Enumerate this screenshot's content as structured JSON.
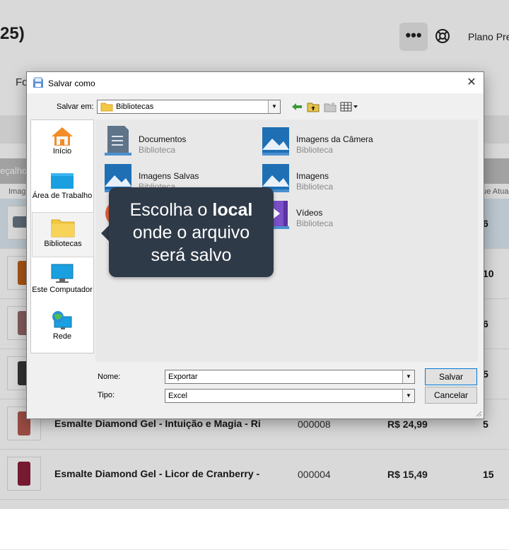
{
  "background": {
    "title": "25)",
    "more_label": "•••",
    "plan_label": "Plano Pre",
    "toolbar_label": "Fo",
    "header_left": "eçalho",
    "subheader_left": "Imag",
    "subheader_right": "que Atua",
    "rows": [
      {
        "name": "",
        "code": "",
        "price": "",
        "stock": "6",
        "bottle": "#6b7b88"
      },
      {
        "name": "",
        "code": "",
        "price": "",
        "stock": "10",
        "bottle": "#c5621a"
      },
      {
        "name": "",
        "code": "",
        "price": "",
        "stock": "6",
        "bottle": "#9a6b6b"
      },
      {
        "name": "",
        "code": "",
        "price": "",
        "stock": "5",
        "bottle": "#3a3a3a"
      },
      {
        "name": "Esmalte Diamond Gel - Intuição e Magia - Ri",
        "code": "000008",
        "price": "R$ 24,99",
        "stock": "5",
        "bottle": "#b55a4f"
      },
      {
        "name": "Esmalte Diamond Gel - Licor de Cranberry -",
        "code": "000004",
        "price": "R$ 15,49",
        "stock": "15",
        "bottle": "#8a1f3a"
      }
    ]
  },
  "dialog": {
    "title": "Salvar como",
    "close_label": "✕",
    "save_in_label": "Salvar em:",
    "save_in_value": "Bibliotecas",
    "places": [
      {
        "label": "Início",
        "icon": "home-icon"
      },
      {
        "label": "Área de Trabalho",
        "icon": "desktop-icon"
      },
      {
        "label": "Bibliotecas",
        "icon": "libraries-icon"
      },
      {
        "label": "Este Computador",
        "icon": "computer-icon"
      },
      {
        "label": "Rede",
        "icon": "network-icon"
      }
    ],
    "items": [
      {
        "name": "Documentos",
        "type": "Biblioteca",
        "icon": "documents-library-icon"
      },
      {
        "name": "Imagens da Câmera",
        "type": "Biblioteca",
        "icon": "camera-roll-library-icon"
      },
      {
        "name": "Imagens Salvas",
        "type": "Biblioteca",
        "icon": "saved-pictures-library-icon"
      },
      {
        "name": "Imagens",
        "type": "Biblioteca",
        "icon": "pictures-library-icon"
      },
      {
        "name": "Vídeos",
        "type": "Biblioteca",
        "icon": "videos-library-icon"
      }
    ],
    "name_label": "Nome:",
    "name_value": "Exportar",
    "type_label": "Tipo:",
    "type_value": "Excel",
    "save_button": "Salvar",
    "cancel_button": "Cancelar"
  },
  "tooltip": {
    "line1_prefix": "Escolha o ",
    "line1_bold": "local",
    "line2": "onde o arquivo",
    "line3": "será salvo"
  },
  "colors": {
    "tooltip_bg": "#2f3a48",
    "library_blue": "#1f6fb5",
    "folder_yellow": "#f2c744"
  }
}
